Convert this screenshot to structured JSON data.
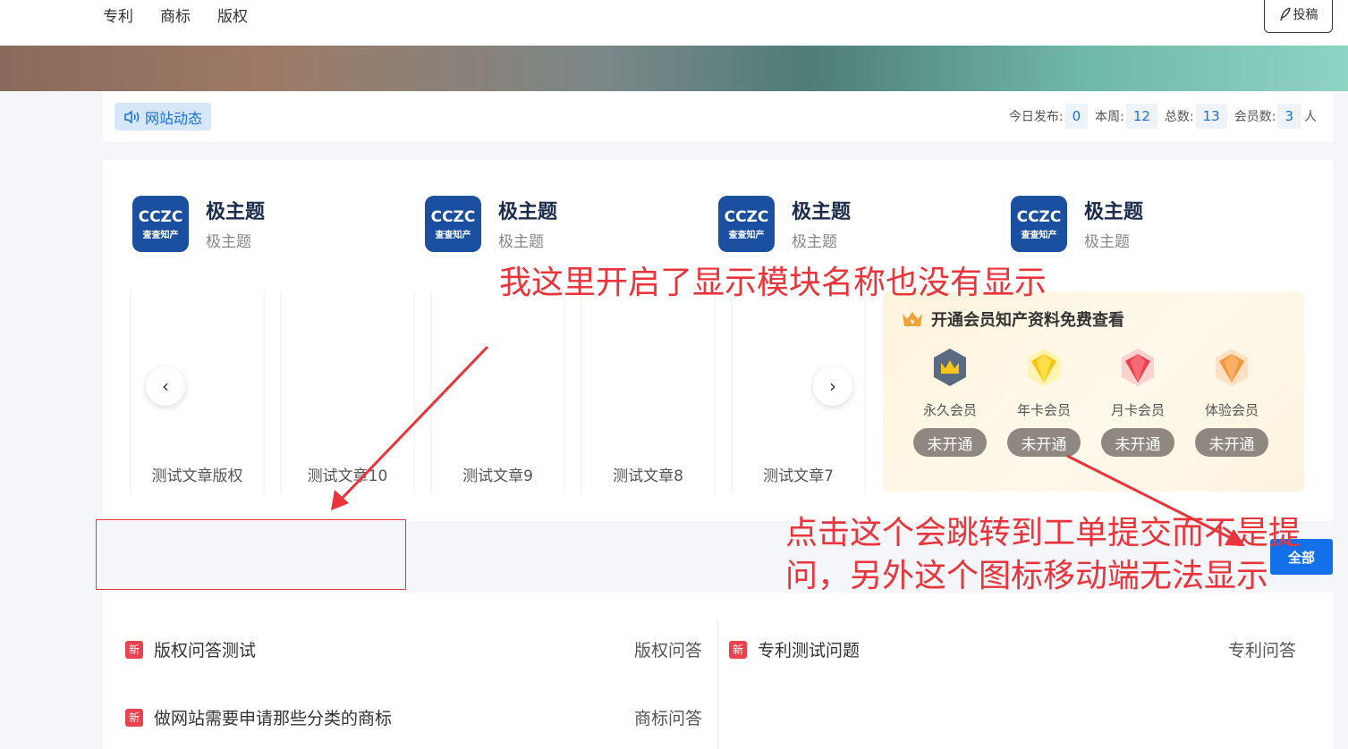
{
  "nav": {
    "links": [
      "专利",
      "商标",
      "版权"
    ],
    "submit_label": "投稿"
  },
  "notice": {
    "tag_label": "网站动态",
    "stats": {
      "today_label": "今日发布:",
      "today_value": "0",
      "week_label": "本周:",
      "week_value": "12",
      "total_label": "总数:",
      "total_value": "13",
      "members_label": "会员数:",
      "members_value": "3",
      "members_unit": "人"
    }
  },
  "profiles": [
    {
      "logo_top": "CCZC",
      "logo_bottom": "查查知产",
      "title": "极主题",
      "subtitle": "极主题"
    },
    {
      "logo_top": "CCZC",
      "logo_bottom": "查查知产",
      "title": "极主题",
      "subtitle": "极主题"
    },
    {
      "logo_top": "CCZC",
      "logo_bottom": "查查知产",
      "title": "极主题",
      "subtitle": "极主题"
    },
    {
      "logo_top": "CCZC",
      "logo_bottom": "查查知产",
      "title": "极主题",
      "subtitle": "极主题"
    }
  ],
  "carousel": {
    "prev_glyph": "‹",
    "next_glyph": "›",
    "slides": [
      "测试文章版权",
      "测试文章10",
      "测试文章9",
      "测试文章8",
      "测试文章7"
    ]
  },
  "vip": {
    "title": "开通会员知产资料免费查看",
    "tiers": [
      {
        "name": "永久会员",
        "status": "未开通",
        "gem_color": "#5a6a80",
        "icon": "crown-badge-icon"
      },
      {
        "name": "年卡会员",
        "status": "未开通",
        "gem_color": "#f5c518",
        "icon": "diamond-icon"
      },
      {
        "name": "月卡会员",
        "status": "未开通",
        "gem_color": "#e8434f",
        "icon": "diamond-icon"
      },
      {
        "name": "体验会员",
        "status": "未开通",
        "gem_color": "#f5963a",
        "icon": "diamond-icon"
      }
    ]
  },
  "all_button": "全部",
  "qa": [
    {
      "badge": "新",
      "title": "版权问答测试",
      "category": "版权问答"
    },
    {
      "badge": "新",
      "title": "专利测试问题",
      "category": "专利问答"
    },
    {
      "badge": "新",
      "title": "做网站需要申请那些分类的商标",
      "category": "商标问答"
    }
  ],
  "annotations": {
    "top": "我这里开启了显示模块名称也没有显示",
    "bottom_line1": "点击这个会跳转到工单提交而不是提",
    "bottom_line2": "问，另外这个图标移动端无法显示"
  },
  "colors": {
    "accent": "#1470e8",
    "annotation": "#e8343a",
    "badge": "#e8434f",
    "logo": "#1b4fa0"
  }
}
